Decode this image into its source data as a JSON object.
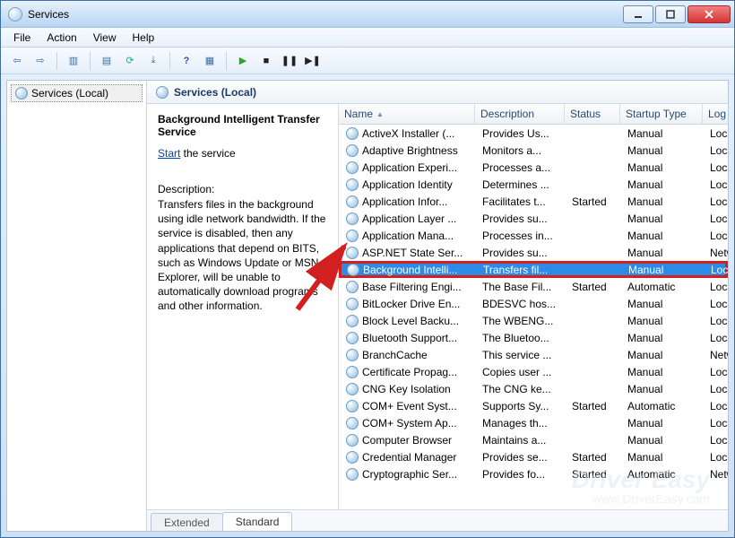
{
  "window": {
    "title": "Services"
  },
  "menus": {
    "file": "File",
    "action": "Action",
    "view": "View",
    "help": "Help"
  },
  "tree": {
    "root": "Services (Local)"
  },
  "paneHeader": "Services (Local)",
  "detail": {
    "serviceName": "Background Intelligent Transfer Service",
    "startLink": "Start",
    "startText": " the service",
    "descLabel": "Description:",
    "descText": "Transfers files in the background using idle network bandwidth. If the service is disabled, then any applications that depend on BITS, such as Windows Update or MSN Explorer, will be unable to automatically download programs and other information."
  },
  "columns": {
    "name": "Name",
    "description": "Description",
    "status": "Status",
    "startupType": "Startup Type",
    "logOnAs": "Log On As"
  },
  "rows": [
    {
      "name": "ActiveX Installer (...",
      "desc": "Provides Us...",
      "status": "",
      "startup": "Manual",
      "logon": "Local Syste..."
    },
    {
      "name": "Adaptive Brightness",
      "desc": "Monitors a...",
      "status": "",
      "startup": "Manual",
      "logon": "Local Service"
    },
    {
      "name": "Application Experi...",
      "desc": "Processes a...",
      "status": "",
      "startup": "Manual",
      "logon": "Local Syste..."
    },
    {
      "name": "Application Identity",
      "desc": "Determines ...",
      "status": "",
      "startup": "Manual",
      "logon": "Local Service"
    },
    {
      "name": "Application Infor...",
      "desc": "Facilitates t...",
      "status": "Started",
      "startup": "Manual",
      "logon": "Local Syste..."
    },
    {
      "name": "Application Layer ...",
      "desc": "Provides su...",
      "status": "",
      "startup": "Manual",
      "logon": "Local Service"
    },
    {
      "name": "Application Mana...",
      "desc": "Processes in...",
      "status": "",
      "startup": "Manual",
      "logon": "Local Syste..."
    },
    {
      "name": "ASP.NET State Ser...",
      "desc": "Provides su...",
      "status": "",
      "startup": "Manual",
      "logon": "Network S..."
    },
    {
      "name": "Background Intelli...",
      "desc": "Transfers fil...",
      "status": "",
      "startup": "Manual",
      "logon": "Local Syste...",
      "selected": true
    },
    {
      "name": "Base Filtering Engi...",
      "desc": "The Base Fil...",
      "status": "Started",
      "startup": "Automatic",
      "logon": "Local Service"
    },
    {
      "name": "BitLocker Drive En...",
      "desc": "BDESVC hos...",
      "status": "",
      "startup": "Manual",
      "logon": "Local Syste..."
    },
    {
      "name": "Block Level Backu...",
      "desc": "The WBENG...",
      "status": "",
      "startup": "Manual",
      "logon": "Local Syste..."
    },
    {
      "name": "Bluetooth Support...",
      "desc": "The Bluetoo...",
      "status": "",
      "startup": "Manual",
      "logon": "Local Service"
    },
    {
      "name": "BranchCache",
      "desc": "This service ...",
      "status": "",
      "startup": "Manual",
      "logon": "Network S..."
    },
    {
      "name": "Certificate Propag...",
      "desc": "Copies user ...",
      "status": "",
      "startup": "Manual",
      "logon": "Local Syste..."
    },
    {
      "name": "CNG Key Isolation",
      "desc": "The CNG ke...",
      "status": "",
      "startup": "Manual",
      "logon": "Local Syste..."
    },
    {
      "name": "COM+ Event Syst...",
      "desc": "Supports Sy...",
      "status": "Started",
      "startup": "Automatic",
      "logon": "Local Service"
    },
    {
      "name": "COM+ System Ap...",
      "desc": "Manages th...",
      "status": "",
      "startup": "Manual",
      "logon": "Local Syste..."
    },
    {
      "name": "Computer Browser",
      "desc": "Maintains a...",
      "status": "",
      "startup": "Manual",
      "logon": "Local Syste..."
    },
    {
      "name": "Credential Manager",
      "desc": "Provides se...",
      "status": "Started",
      "startup": "Manual",
      "logon": "Local Syste..."
    },
    {
      "name": "Cryptographic Ser...",
      "desc": "Provides fo...",
      "status": "Started",
      "startup": "Automatic",
      "logon": "Network S..."
    }
  ],
  "tabs": {
    "extended": "Extended",
    "standard": "Standard"
  },
  "watermark": {
    "brand": "Driver Easy",
    "url": "www.DriverEasy.com"
  }
}
